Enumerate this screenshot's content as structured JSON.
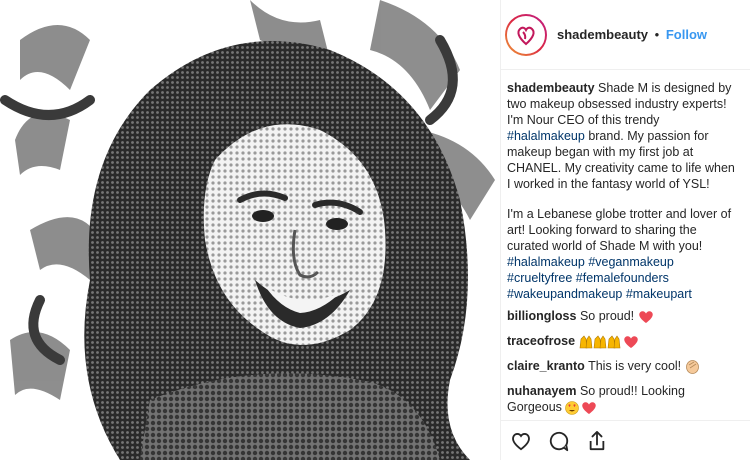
{
  "header": {
    "username": "shadembeauty",
    "separator": "•",
    "follow_label": "Follow"
  },
  "caption": {
    "username": "shadembeauty",
    "p1_a": "Shade M is designed by two makeup obsessed industry experts! I'm Nour CEO of this trendy ",
    "p1_tag": "#halalmakeup",
    "p1_b": " brand. My passion for makeup began with my first job at CHANEL. My creativity came to life when I worked in the fantasy world of YSL!",
    "p2": "I'm a Lebanese globe trotter and lover of art! Looking forward to sharing the curated world of Shade M with you!",
    "hashtags": [
      "#halalmakeup",
      "#veganmakeup",
      "#crueltyfree",
      "#femalefounders",
      "#wakeupandmakeup",
      "#makeupart"
    ]
  },
  "comments": [
    {
      "username": "billiongloss",
      "text": "So proud!",
      "emoji": "heart"
    },
    {
      "username": "traceofrose",
      "text": "",
      "emoji": "raised-hands-heart"
    },
    {
      "username": "claire_kranto",
      "text": "This is very cool!",
      "emoji": "clap"
    },
    {
      "username": "nuhanayem",
      "text": "So proud!! Looking Gorgeous",
      "emoji": "heart-eyes-heart"
    }
  ],
  "icons": {
    "like": "heart-icon",
    "comment": "comment-icon",
    "share": "share-icon"
  },
  "colors": {
    "link": "#3897f0",
    "hashtag": "#003569",
    "heart": "#ed4956"
  }
}
